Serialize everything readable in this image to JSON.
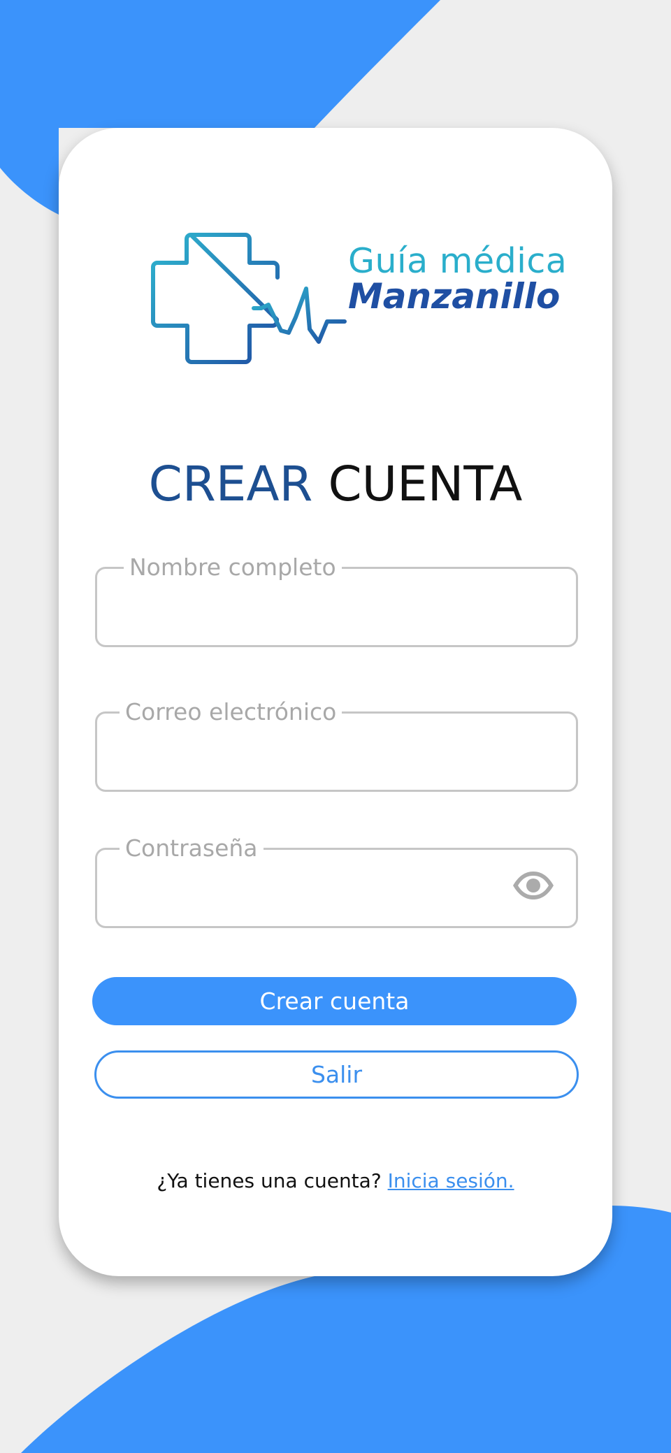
{
  "logo": {
    "line1": "Guía médica",
    "line2": "Manzanillo"
  },
  "title": {
    "accent": "CREAR",
    "rest": "CUENTA"
  },
  "fields": {
    "name": {
      "label": "Nombre completo",
      "value": ""
    },
    "email": {
      "label": "Correo electrónico",
      "value": ""
    },
    "password": {
      "label": "Contraseña",
      "value": ""
    }
  },
  "buttons": {
    "create": "Crear cuenta",
    "exit": "Salir"
  },
  "footer": {
    "prompt": "¿Ya tienes una cuenta?",
    "link": "Inicia sesión."
  },
  "colors": {
    "primary": "#3b93fb",
    "title_accent": "#1d4f91",
    "logo_teal": "#2aaecb",
    "logo_navy": "#1f4fa3",
    "background": "#eeeeee",
    "card": "#ffffff"
  },
  "icons": {
    "logo_mark": "medical-cross-heartbeat-icon",
    "password_toggle": "eye-icon"
  }
}
